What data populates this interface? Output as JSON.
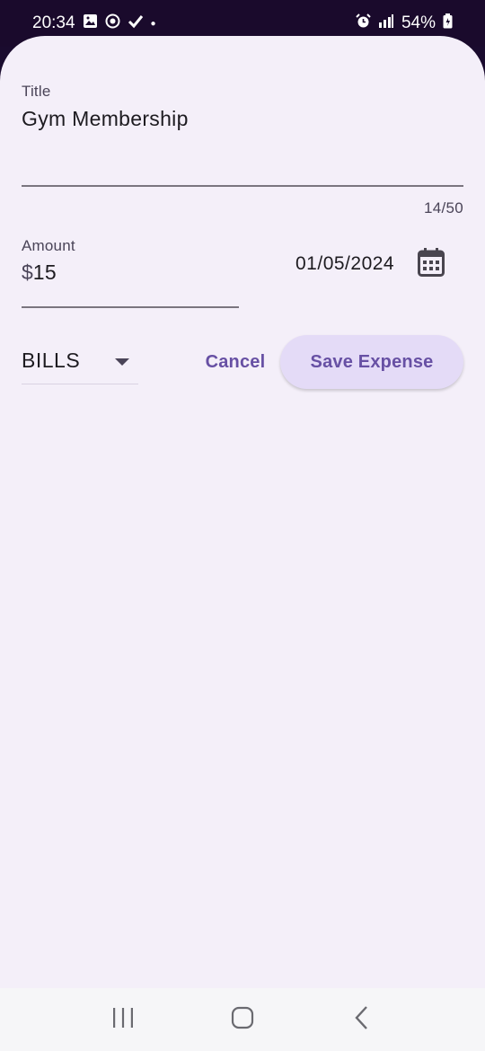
{
  "status_bar": {
    "time": "20:34",
    "battery": "54%",
    "left_icons": [
      "image-icon",
      "face-icon",
      "check-icon",
      "dot-icon"
    ],
    "right_icons": [
      "alarm-icon",
      "signal-icon",
      "battery-icon"
    ]
  },
  "form": {
    "title": {
      "label": "Title",
      "value": "Gym Membership",
      "counter": "14/50"
    },
    "amount": {
      "label": "Amount",
      "prefix": "$",
      "value": "15"
    },
    "date": {
      "value": "01/05/2024",
      "icon": "calendar-icon"
    },
    "category": {
      "selected": "BILLS"
    },
    "actions": {
      "cancel_label": "Cancel",
      "save_label": "Save Expense"
    }
  },
  "colors": {
    "sheet_background": "#f4eff9",
    "primary": "#6750a4",
    "save_button_bg": "#e4dbf7",
    "status_bar_bg": "#1a0a2c"
  },
  "nav_bar": {
    "buttons": [
      "recents-icon",
      "home-icon",
      "back-icon"
    ]
  }
}
